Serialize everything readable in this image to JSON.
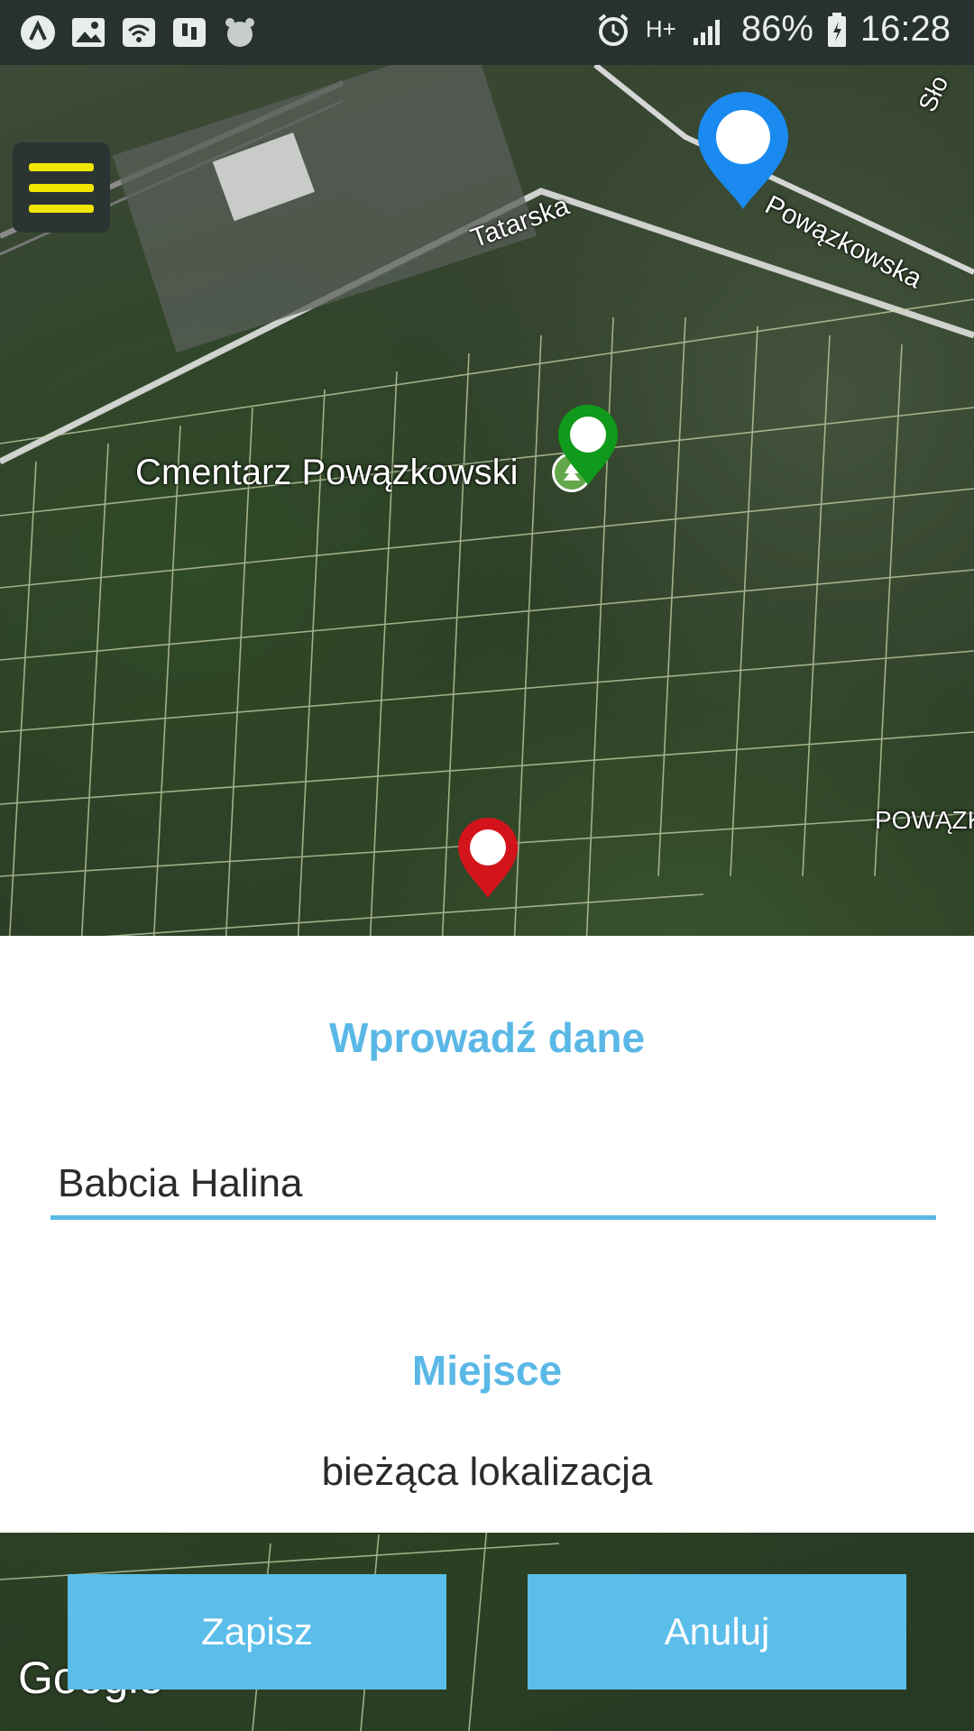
{
  "status_bar": {
    "battery": "86%",
    "time": "16:28",
    "network": "H+",
    "left_icons": [
      "app-a-icon",
      "image-icon",
      "wifi-icon",
      "tasks-icon",
      "alarm-clock-icon"
    ],
    "right_icons": [
      "alarm-icon",
      "data-icon",
      "signal-icon",
      "battery-icon"
    ]
  },
  "map": {
    "labels": {
      "street_tatarska": "Tatarska",
      "street_powazkowska": "Powązkowska",
      "street_slo": "Sło",
      "cemetery": "Cmentarz Powązkowski",
      "powazk": "POWĄZK"
    },
    "pins": [
      {
        "name": "current-location-pin",
        "color": "#1a8af0"
      },
      {
        "name": "cemetery-pin",
        "color": "#0f9a1b"
      },
      {
        "name": "selected-place-pin",
        "color": "#d3141b"
      }
    ],
    "attribution": "Google"
  },
  "form": {
    "title": "Wprowadź dane",
    "name_value": "Babcia Halina",
    "place_label": "Miejsce",
    "place_value": "bieżąca lokalizacja"
  },
  "buttons": {
    "save": "Zapisz",
    "cancel": "Anuluj"
  },
  "colors": {
    "accent": "#5ab8e6",
    "button": "#5bbde9",
    "menu_bar": "#f2e600"
  }
}
